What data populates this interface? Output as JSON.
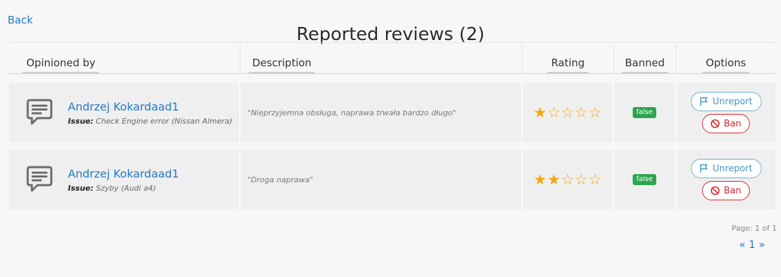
{
  "nav": {
    "back_label": "Back"
  },
  "page": {
    "title": "Reported reviews (2)"
  },
  "table": {
    "columns": [
      "Opinioned by",
      "Description",
      "Rating",
      "Banned",
      "Options"
    ],
    "rows": [
      {
        "author": "Andrzej Kokardaad1",
        "issue_label": "Issue:",
        "issue": "Check Engine error (Nissan Almera)",
        "description": "\"Nieprzyjemna obsługa, naprawa trwała bardzo długo\"",
        "rating": 1,
        "rating_max": 5,
        "banned": "false",
        "unreport_label": "Unreport",
        "ban_label": "Ban"
      },
      {
        "author": "Andrzej Kokardaad1",
        "issue_label": "Issue:",
        "issue": "Szyby (Audi a4)",
        "description": "\"Droga naprawa\"",
        "rating": 2,
        "rating_max": 5,
        "banned": "false",
        "unreport_label": "Unreport",
        "ban_label": "Ban"
      }
    ]
  },
  "pagination": {
    "page_info": "Page: 1 of 1",
    "prev": "«",
    "current": "1",
    "next": "»"
  },
  "icons": {
    "row_icon": "comment-icon",
    "unreport_icon": "flag-icon",
    "ban_icon": "ban-icon",
    "star_icon": "star-icon"
  },
  "colors": {
    "link": "#1f7ac9",
    "badge_false": "#2ea44f",
    "star": "#f5a50c",
    "unreport": "#3f97c4",
    "ban": "#d9232f"
  }
}
